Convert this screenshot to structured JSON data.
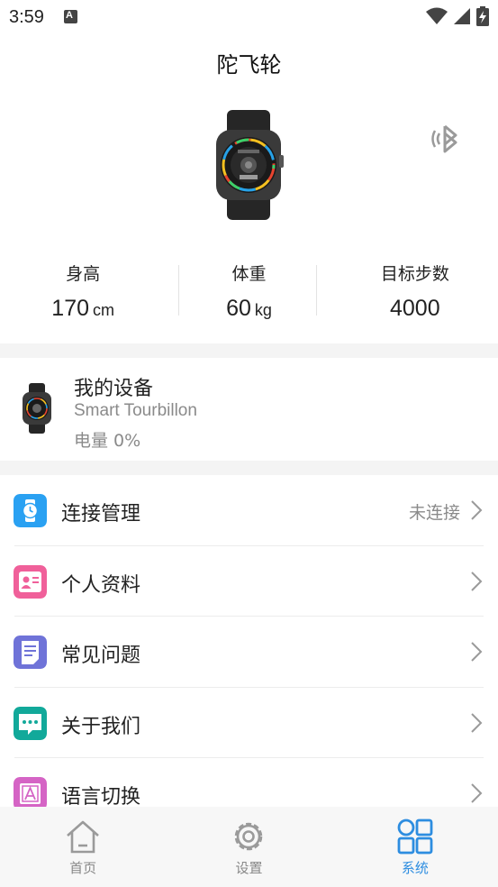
{
  "status_bar": {
    "time": "3:59",
    "notification_letter": "A"
  },
  "header": {
    "title": "陀飞轮"
  },
  "stats": [
    {
      "label": "身高",
      "value": "170",
      "unit": "cm"
    },
    {
      "label": "体重",
      "value": "60",
      "unit": "kg"
    },
    {
      "label": "目标步数",
      "value": "4000",
      "unit": ""
    }
  ],
  "device": {
    "title": "我的设备",
    "model": "Smart Tourbillon",
    "battery": "电量 0%"
  },
  "menu": [
    {
      "label": "连接管理",
      "status": "未连接",
      "icon": "watch-icon",
      "color": "#2aa1f2"
    },
    {
      "label": "个人资料",
      "status": "",
      "icon": "profile-card-icon",
      "color": "#f0609a"
    },
    {
      "label": "常见问题",
      "status": "",
      "icon": "document-icon",
      "color": "#6f73d8"
    },
    {
      "label": "关于我们",
      "status": "",
      "icon": "chat-bubble-icon",
      "color": "#12a99a"
    },
    {
      "label": "语言切换",
      "status": "",
      "icon": "language-icon",
      "color": "#d564c5"
    }
  ],
  "bottom_nav": [
    {
      "label": "首页",
      "icon": "home-icon",
      "active": false
    },
    {
      "label": "设置",
      "icon": "gear-icon",
      "active": false
    },
    {
      "label": "系统",
      "icon": "grid-icon",
      "active": true
    }
  ],
  "colors": {
    "accent": "#2d8de0",
    "muted_text": "#8a8a8a"
  }
}
